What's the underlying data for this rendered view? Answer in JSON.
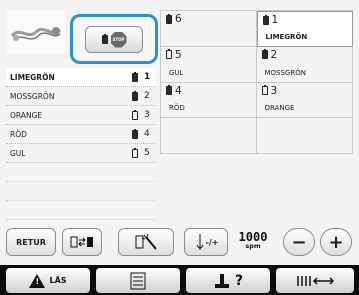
{
  "stop_button": {
    "icon": "stop-icon",
    "label": "STOP"
  },
  "color_list": [
    {
      "name": "LIMEGRÖN",
      "spool": "filled",
      "number": "1",
      "selected": true
    },
    {
      "name": "MOSSGRÖN",
      "spool": "filled",
      "number": "2"
    },
    {
      "name": "ORANGE",
      "spool": "empty",
      "number": "3"
    },
    {
      "name": "RÖD",
      "spool": "filled",
      "number": "4"
    },
    {
      "name": "GUL",
      "spool": "empty",
      "number": "5"
    }
  ],
  "needles": [
    {
      "number": "6",
      "color_name": "",
      "spool": "filled"
    },
    {
      "number": "1",
      "color_name": "LIMEGRÖN",
      "spool": "filled",
      "highlight": true
    },
    {
      "number": "5",
      "color_name": "GUL",
      "spool": "empty"
    },
    {
      "number": "2",
      "color_name": "MOSSGRÖN",
      "spool": "filled"
    },
    {
      "number": "4",
      "color_name": "RÖD",
      "spool": "filled"
    },
    {
      "number": "3",
      "color_name": "ORANGE",
      "spool": "empty"
    },
    {
      "number": "",
      "color_name": "",
      "spool": ""
    },
    {
      "number": "",
      "color_name": "",
      "spool": ""
    }
  ],
  "toolbar": {
    "return_label": "RETUR",
    "speed_value": "1000",
    "speed_unit": "spm",
    "minus_label": "−",
    "plus_label": "+",
    "thread_speed_label": "-/+"
  },
  "bottom_bar": {
    "lock_label": "LÅS",
    "help_label": "?"
  },
  "colors": {
    "highlight_border": "#2c8fd8",
    "bar": "#0c0c0c"
  }
}
